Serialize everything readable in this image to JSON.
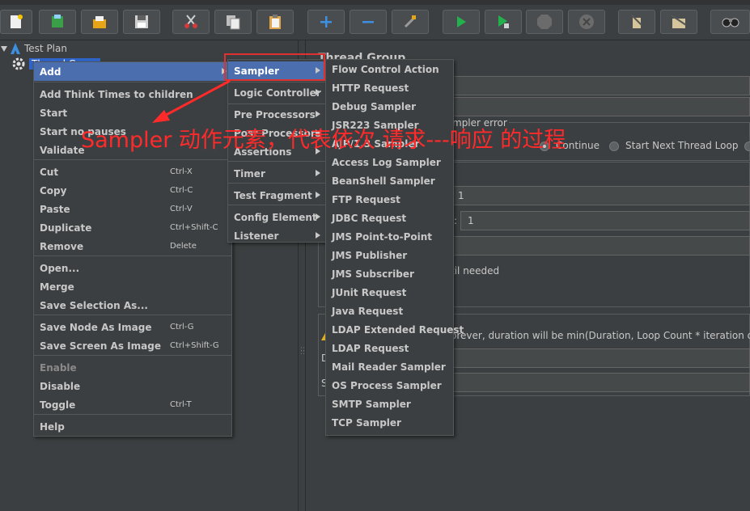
{
  "toolbar": {
    "buttons": [
      "new-icon",
      "templates-icon",
      "open-icon",
      "save-icon",
      "cut-icon",
      "copy-icon",
      "paste-icon",
      "expand-icon",
      "collapse-icon",
      "toggle-icon",
      "start-icon",
      "start-no-pauses-icon",
      "stop-icon",
      "shutdown-icon",
      "clear-icon",
      "clear-all-icon",
      "search-icon"
    ]
  },
  "tree": {
    "test_plan": "Test Plan",
    "thread_group": "Thread Group"
  },
  "right": {
    "title": "Thread Group",
    "sampler_error": "mpler error",
    "continue": "Continue",
    "start_next": "Start Next Thread Loop",
    "field1": "1",
    "field2_label": ":",
    "field2": "1",
    "until_needed": "til needed",
    "duration_note": "orever, duration will be min(Duration, Loop Count * iteration durati",
    "side_d": "D",
    "side_s": "S",
    "side_e": "E",
    "side_s2": "S"
  },
  "context_menu": {
    "items": [
      {
        "label": "Add",
        "accel": ""
      },
      {
        "label": "Add Think Times to children",
        "accel": ""
      },
      {
        "label": "Start",
        "accel": ""
      },
      {
        "label": "Start no pauses",
        "accel": ""
      },
      {
        "label": "Validate",
        "accel": ""
      },
      {
        "label": "Cut",
        "accel": "Ctrl-X"
      },
      {
        "label": "Copy",
        "accel": "Ctrl-C"
      },
      {
        "label": "Paste",
        "accel": "Ctrl-V"
      },
      {
        "label": "Duplicate",
        "accel": "Ctrl+Shift-C"
      },
      {
        "label": "Remove",
        "accel": "Delete"
      },
      {
        "label": "Open...",
        "accel": ""
      },
      {
        "label": "Merge",
        "accel": ""
      },
      {
        "label": "Save Selection As...",
        "accel": ""
      },
      {
        "label": "Save Node As Image",
        "accel": "Ctrl-G"
      },
      {
        "label": "Save Screen As Image",
        "accel": "Ctrl+Shift-G"
      },
      {
        "label": "Enable",
        "accel": ""
      },
      {
        "label": "Disable",
        "accel": ""
      },
      {
        "label": "Toggle",
        "accel": "Ctrl-T"
      },
      {
        "label": "Help",
        "accel": ""
      }
    ]
  },
  "add_menu": {
    "items": [
      "Sampler",
      "Logic Controller",
      "Pre Processors",
      "Post Processors",
      "Assertions",
      "Timer",
      "Test Fragment",
      "Config Element",
      "Listener"
    ]
  },
  "sampler_menu": {
    "items": [
      "Flow Control Action",
      "HTTP Request",
      "Debug Sampler",
      "JSR223 Sampler",
      "AJP/1.3 Sampler",
      "Access Log Sampler",
      "BeanShell Sampler",
      "FTP Request",
      "JDBC Request",
      "JMS Point-to-Point",
      "JMS Publisher",
      "JMS Subscriber",
      "JUnit Request",
      "Java Request",
      "LDAP Extended Request",
      "LDAP Request",
      "Mail Reader Sampler",
      "OS Process Sampler",
      "SMTP Sampler",
      "TCP Sampler"
    ]
  },
  "annotation": {
    "text": "Sampler 动作元素，代表依次 请求---响应 的过程",
    "color": "#ff2a2a"
  },
  "colors": {
    "background": "#3c3f41",
    "selection": "#4b6eaf",
    "tree_selection": "#2f65ca",
    "highlight_box": "#e03030"
  }
}
